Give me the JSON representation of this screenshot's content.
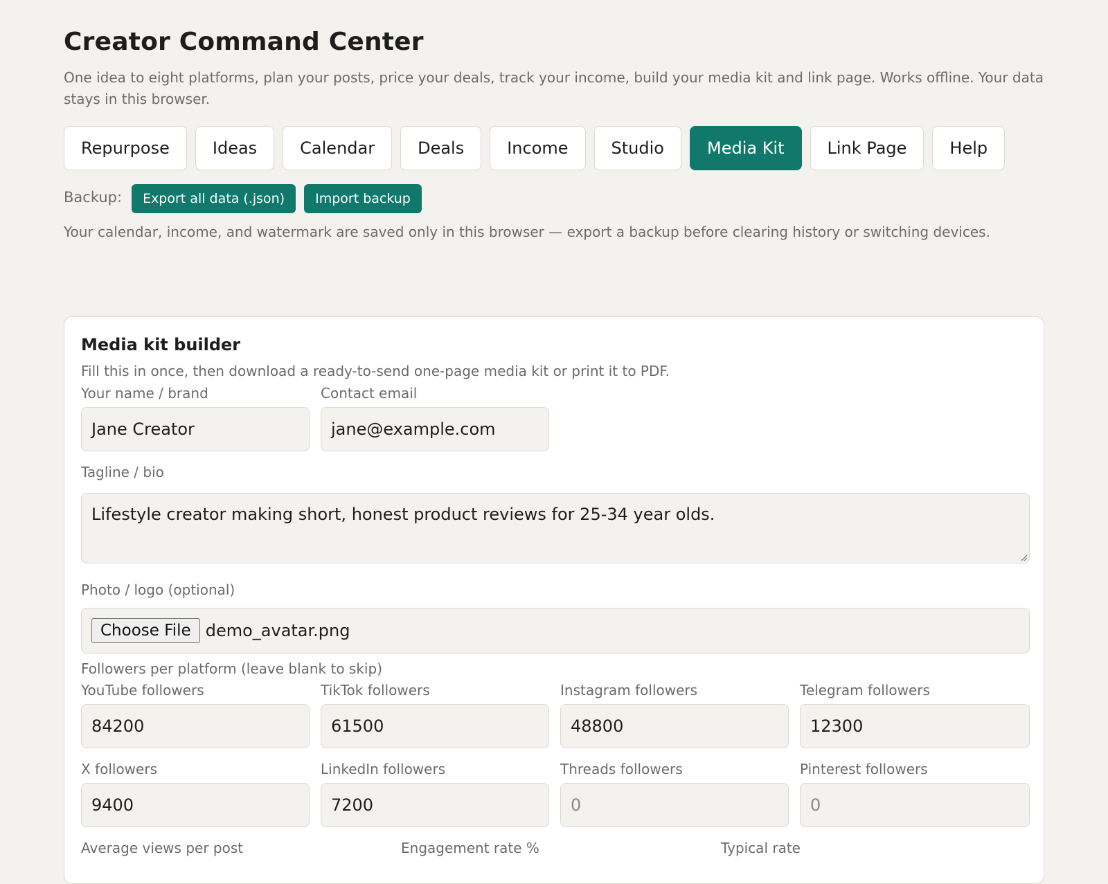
{
  "app": {
    "title": "Creator Command Center",
    "subtitle": "One idea to eight platforms, plan your posts, price your deals, track your income, build your media kit and link page. Works offline. Your data stays in this browser."
  },
  "tabs": [
    {
      "label": "Repurpose",
      "active": false
    },
    {
      "label": "Ideas",
      "active": false
    },
    {
      "label": "Calendar",
      "active": false
    },
    {
      "label": "Deals",
      "active": false
    },
    {
      "label": "Income",
      "active": false
    },
    {
      "label": "Studio",
      "active": false
    },
    {
      "label": "Media Kit",
      "active": true
    },
    {
      "label": "Link Page",
      "active": false
    },
    {
      "label": "Help",
      "active": false
    }
  ],
  "backup": {
    "label": "Backup:",
    "export_label": "Export all data (.json)",
    "import_label": "Import backup",
    "note": "Your calendar, income, and watermark are saved only in this browser — export a backup before clearing history or switching devices."
  },
  "media_kit": {
    "title": "Media kit builder",
    "description": "Fill this in once, then download a ready-to-send one-page media kit or print it to PDF.",
    "name": {
      "label": "Your name / brand",
      "value": "Jane Creator"
    },
    "email": {
      "label": "Contact email",
      "value": "jane@example.com"
    },
    "tagline": {
      "label": "Tagline / bio",
      "value": "Lifestyle creator making short, honest product reviews for 25-34 year olds."
    },
    "photo": {
      "label": "Photo / logo (optional)",
      "button": "Choose File",
      "filename": "demo_avatar.png"
    },
    "followers_heading": "Followers per platform (leave blank to skip)",
    "followers": {
      "youtube": {
        "label": "YouTube followers",
        "value": "84200"
      },
      "tiktok": {
        "label": "TikTok followers",
        "value": "61500"
      },
      "instagram": {
        "label": "Instagram followers",
        "value": "48800"
      },
      "telegram": {
        "label": "Telegram followers",
        "value": "12300"
      },
      "x": {
        "label": "X followers",
        "value": "9400"
      },
      "linkedin": {
        "label": "LinkedIn followers",
        "value": "7200"
      },
      "threads": {
        "label": "Threads followers",
        "placeholder": "0"
      },
      "pinterest": {
        "label": "Pinterest followers",
        "placeholder": "0"
      }
    },
    "avg_views_label": "Average views per post",
    "engagement_label": "Engagement rate %",
    "typical_rate_label": "Typical rate"
  },
  "colors": {
    "accent": "#11796b",
    "background": "#f4f2ee"
  }
}
